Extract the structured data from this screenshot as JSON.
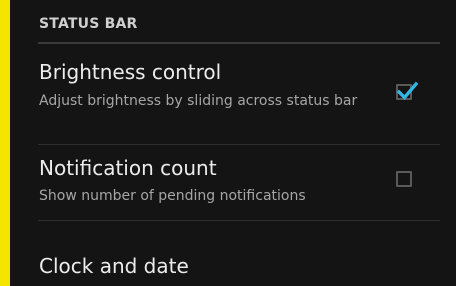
{
  "section": {
    "title": "STATUS BAR"
  },
  "preferences": [
    {
      "title": "Brightness control",
      "summary": "Adjust brightness by sliding across status bar",
      "checked": true
    },
    {
      "title": "Notification count",
      "summary": "Show number of pending notifications",
      "checked": false
    },
    {
      "title": "Clock and date"
    }
  ],
  "colors": {
    "accent": "#33b5e5",
    "frame_border": "#f5e400",
    "background": "#141414"
  },
  "icons": {
    "checked": "check-icon"
  }
}
